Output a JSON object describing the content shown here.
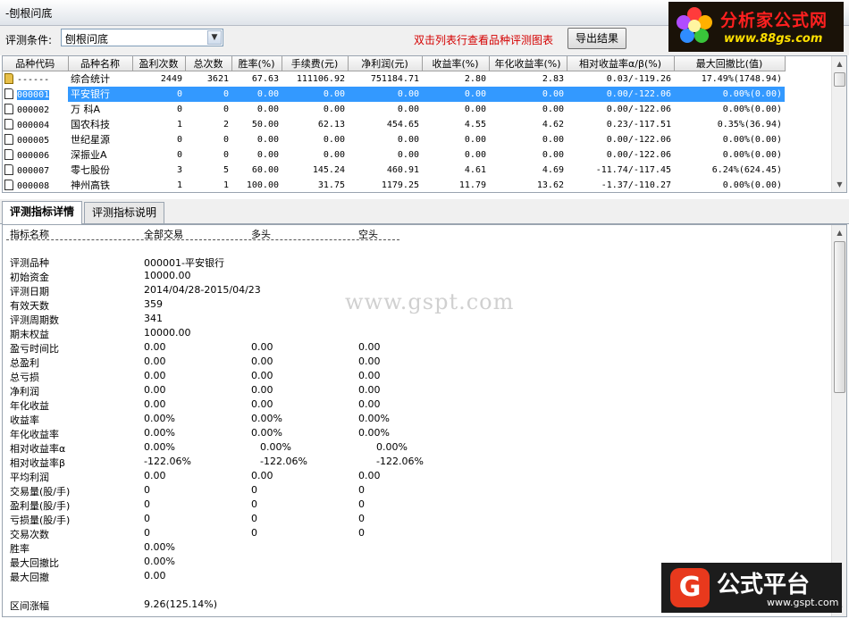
{
  "window": {
    "title": "-刨根问底"
  },
  "toolbar": {
    "condition_label": "评测条件:",
    "condition_value": "刨根问底",
    "hint": "双击列表行查看品种评测图表",
    "export_label": "导出结果"
  },
  "logo_top": {
    "text": "分析家公式网",
    "url": "www.88gs.com"
  },
  "table": {
    "headers": [
      "品种代码",
      "品种名称",
      "盈利次数",
      "总次数",
      "胜率(%)",
      "手续费(元)",
      "净利润(元)",
      "收益率(%)",
      "年化收益率(%)",
      "相对收益率α/β(%)",
      "最大回撤比(值)"
    ],
    "rows": [
      {
        "code": "------",
        "name": "综合统计",
        "wins": "2449",
        "total": "3621",
        "winrate": "67.63",
        "fee": "111106.92",
        "profit": "751184.71",
        "ret": "2.80",
        "annual": "2.83",
        "ab": "0.03/-119.26",
        "dd": "17.49%(1748.94)"
      },
      {
        "code": "000001",
        "name": "平安银行",
        "wins": "0",
        "total": "0",
        "winrate": "0.00",
        "fee": "0.00",
        "profit": "0.00",
        "ret": "0.00",
        "annual": "0.00",
        "ab": "0.00/-122.06",
        "dd": "0.00%(0.00)"
      },
      {
        "code": "000002",
        "name": "万 科A",
        "wins": "0",
        "total": "0",
        "winrate": "0.00",
        "fee": "0.00",
        "profit": "0.00",
        "ret": "0.00",
        "annual": "0.00",
        "ab": "0.00/-122.06",
        "dd": "0.00%(0.00)"
      },
      {
        "code": "000004",
        "name": "国农科技",
        "wins": "1",
        "total": "2",
        "winrate": "50.00",
        "fee": "62.13",
        "profit": "454.65",
        "ret": "4.55",
        "annual": "4.62",
        "ab": "0.23/-117.51",
        "dd": "0.35%(36.94)"
      },
      {
        "code": "000005",
        "name": "世纪星源",
        "wins": "0",
        "total": "0",
        "winrate": "0.00",
        "fee": "0.00",
        "profit": "0.00",
        "ret": "0.00",
        "annual": "0.00",
        "ab": "0.00/-122.06",
        "dd": "0.00%(0.00)"
      },
      {
        "code": "000006",
        "name": "深振业A",
        "wins": "0",
        "total": "0",
        "winrate": "0.00",
        "fee": "0.00",
        "profit": "0.00",
        "ret": "0.00",
        "annual": "0.00",
        "ab": "0.00/-122.06",
        "dd": "0.00%(0.00)"
      },
      {
        "code": "000007",
        "name": "零七股份",
        "wins": "3",
        "total": "5",
        "winrate": "60.00",
        "fee": "145.24",
        "profit": "460.91",
        "ret": "4.61",
        "annual": "4.69",
        "ab": "-11.74/-117.45",
        "dd": "6.24%(624.45)"
      },
      {
        "code": "000008",
        "name": "神州高铁",
        "wins": "1",
        "total": "1",
        "winrate": "100.00",
        "fee": "31.75",
        "profit": "1179.25",
        "ret": "11.79",
        "annual": "13.62",
        "ab": "-1.37/-110.27",
        "dd": "0.00%(0.00)"
      }
    ],
    "selected_index": 1
  },
  "tabs": [
    {
      "label": "评测指标详情",
      "active": true
    },
    {
      "label": "评测指标说明",
      "active": false
    }
  ],
  "detail": {
    "header": [
      "指标名称",
      "全部交易",
      "多头",
      "空头"
    ],
    "rows": [
      [
        "评测品种",
        "000001-平安银行",
        "",
        ""
      ],
      [
        "初始资金",
        "10000.00",
        "",
        ""
      ],
      [
        "评测日期",
        "2014/04/28-2015/04/23",
        "",
        ""
      ],
      [
        "有效天数",
        "359",
        "",
        ""
      ],
      [
        "评测周期数",
        "341",
        "",
        ""
      ],
      [
        "期末权益",
        "10000.00",
        "",
        ""
      ],
      [
        "盈亏时间比",
        "0.00",
        "0.00",
        "0.00"
      ],
      [
        "总盈利",
        "0.00",
        "0.00",
        "0.00"
      ],
      [
        "总亏损",
        "0.00",
        "0.00",
        "0.00"
      ],
      [
        "净利润",
        "0.00",
        "0.00",
        "0.00"
      ],
      [
        "年化收益",
        "0.00",
        "0.00",
        "0.00"
      ],
      [
        "收益率",
        "0.00%",
        "0.00%",
        "0.00%"
      ],
      [
        "年化收益率",
        "0.00%",
        "0.00%",
        "0.00%"
      ],
      [
        "相对收益率α",
        "0.00%",
        "0.00%",
        "0.00%"
      ],
      [
        "相对收益率β",
        "-122.06%",
        "-122.06%",
        "-122.06%"
      ],
      [
        "平均利润",
        "0.00",
        "0.00",
        "0.00"
      ],
      [
        "交易量(股/手)",
        "0",
        "0",
        "0"
      ],
      [
        "盈利量(股/手)",
        "0",
        "0",
        "0"
      ],
      [
        "亏损量(股/手)",
        "0",
        "0",
        "0"
      ],
      [
        "交易次数",
        "0",
        "0",
        "0"
      ],
      [
        "胜率",
        "0.00%",
        "",
        ""
      ],
      [
        "最大回撤比",
        "0.00%",
        "",
        ""
      ],
      [
        "最大回撤",
        "0.00",
        "",
        ""
      ],
      [
        "",
        "",
        "",
        ""
      ],
      [
        "区间涨幅",
        "9.26(125.14%)",
        "",
        ""
      ]
    ]
  },
  "watermark": "www.gspt.com",
  "logo_bottom": {
    "mark": "G",
    "title": "公式平台",
    "url": "www.gspt.com"
  }
}
